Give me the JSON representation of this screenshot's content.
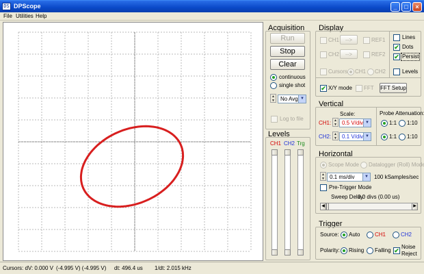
{
  "window": {
    "title": "DPScope",
    "icon_text": "DS",
    "min_label": "_",
    "max_label": "□",
    "close_label": "×"
  },
  "menu": [
    {
      "label": "File"
    },
    {
      "label": "Utilities"
    },
    {
      "label": "Help"
    }
  ],
  "acquisition": {
    "title": "Acquisition",
    "run_label": "Run",
    "stop_label": "Stop",
    "clear_label": "Clear",
    "continuous_label": "continuous",
    "single_shot_label": "single shot",
    "avg_value": "No Avg",
    "log_label": "Log to file",
    "mode_selected": "continuous"
  },
  "levels": {
    "title": "Levels",
    "ch1": "CH1",
    "ch2": "CH2",
    "trg": "Trg"
  },
  "display": {
    "title": "Display",
    "ch1": "CH1",
    "ch2": "CH2",
    "ref1": "REF1",
    "ref2": "REF2",
    "arrow": "-->",
    "cursors": "Cursors",
    "lines": "Lines",
    "dots": "Dots",
    "persist": "Persist",
    "levels": "Levels",
    "xy_mode": "X/Y mode",
    "fft": "FFT",
    "fft_setup": "FFT Setup",
    "dots_checked": true,
    "persist_checked": true,
    "xy_checked": true
  },
  "vertical": {
    "title": "Vertical",
    "scale_label": "Scale:",
    "ch1_label": "CH1:",
    "ch1_value": "0.5 V/div",
    "ch2_label": "CH2:",
    "ch2_value": "0.1 V/div",
    "probe_title": "Probe Attenuation:",
    "opt1": "1:1",
    "opt10": "1:10"
  },
  "horizontal": {
    "title": "Horizontal",
    "scope_mode": "Scope Mode",
    "datalogger_mode": "Datalogger (Roll) Mode",
    "timebase": "0.1 ms/div",
    "sample_rate": "100 kSamples/sec",
    "pretrigger": "Pre-Trigger Mode",
    "sweep_label": "Sweep Delay:",
    "sweep_value": "0.0 divs (0.00 us)"
  },
  "trigger": {
    "title": "Trigger",
    "source_label": "Source:",
    "auto": "Auto",
    "ch1": "CH1",
    "ch2": "CH2",
    "polarity_label": "Polarity:",
    "rising": "Rising",
    "falling": "Falling",
    "noise_reject_1": "Noise",
    "noise_reject_2": "Reject",
    "noise_checked": true
  },
  "status": {
    "cursors_label": "Cursors: dV: 0.000 V",
    "v_pair": "(-4.995 V) (-4.995 V)",
    "dt": "dt: 496.4 us",
    "freq": "1/dt: 2.015 kHz"
  },
  "colors": {
    "trace": "#d81f1f",
    "ch1": "#d40000",
    "ch2": "#1c2fd8",
    "trg": "#1a8a1a"
  }
}
